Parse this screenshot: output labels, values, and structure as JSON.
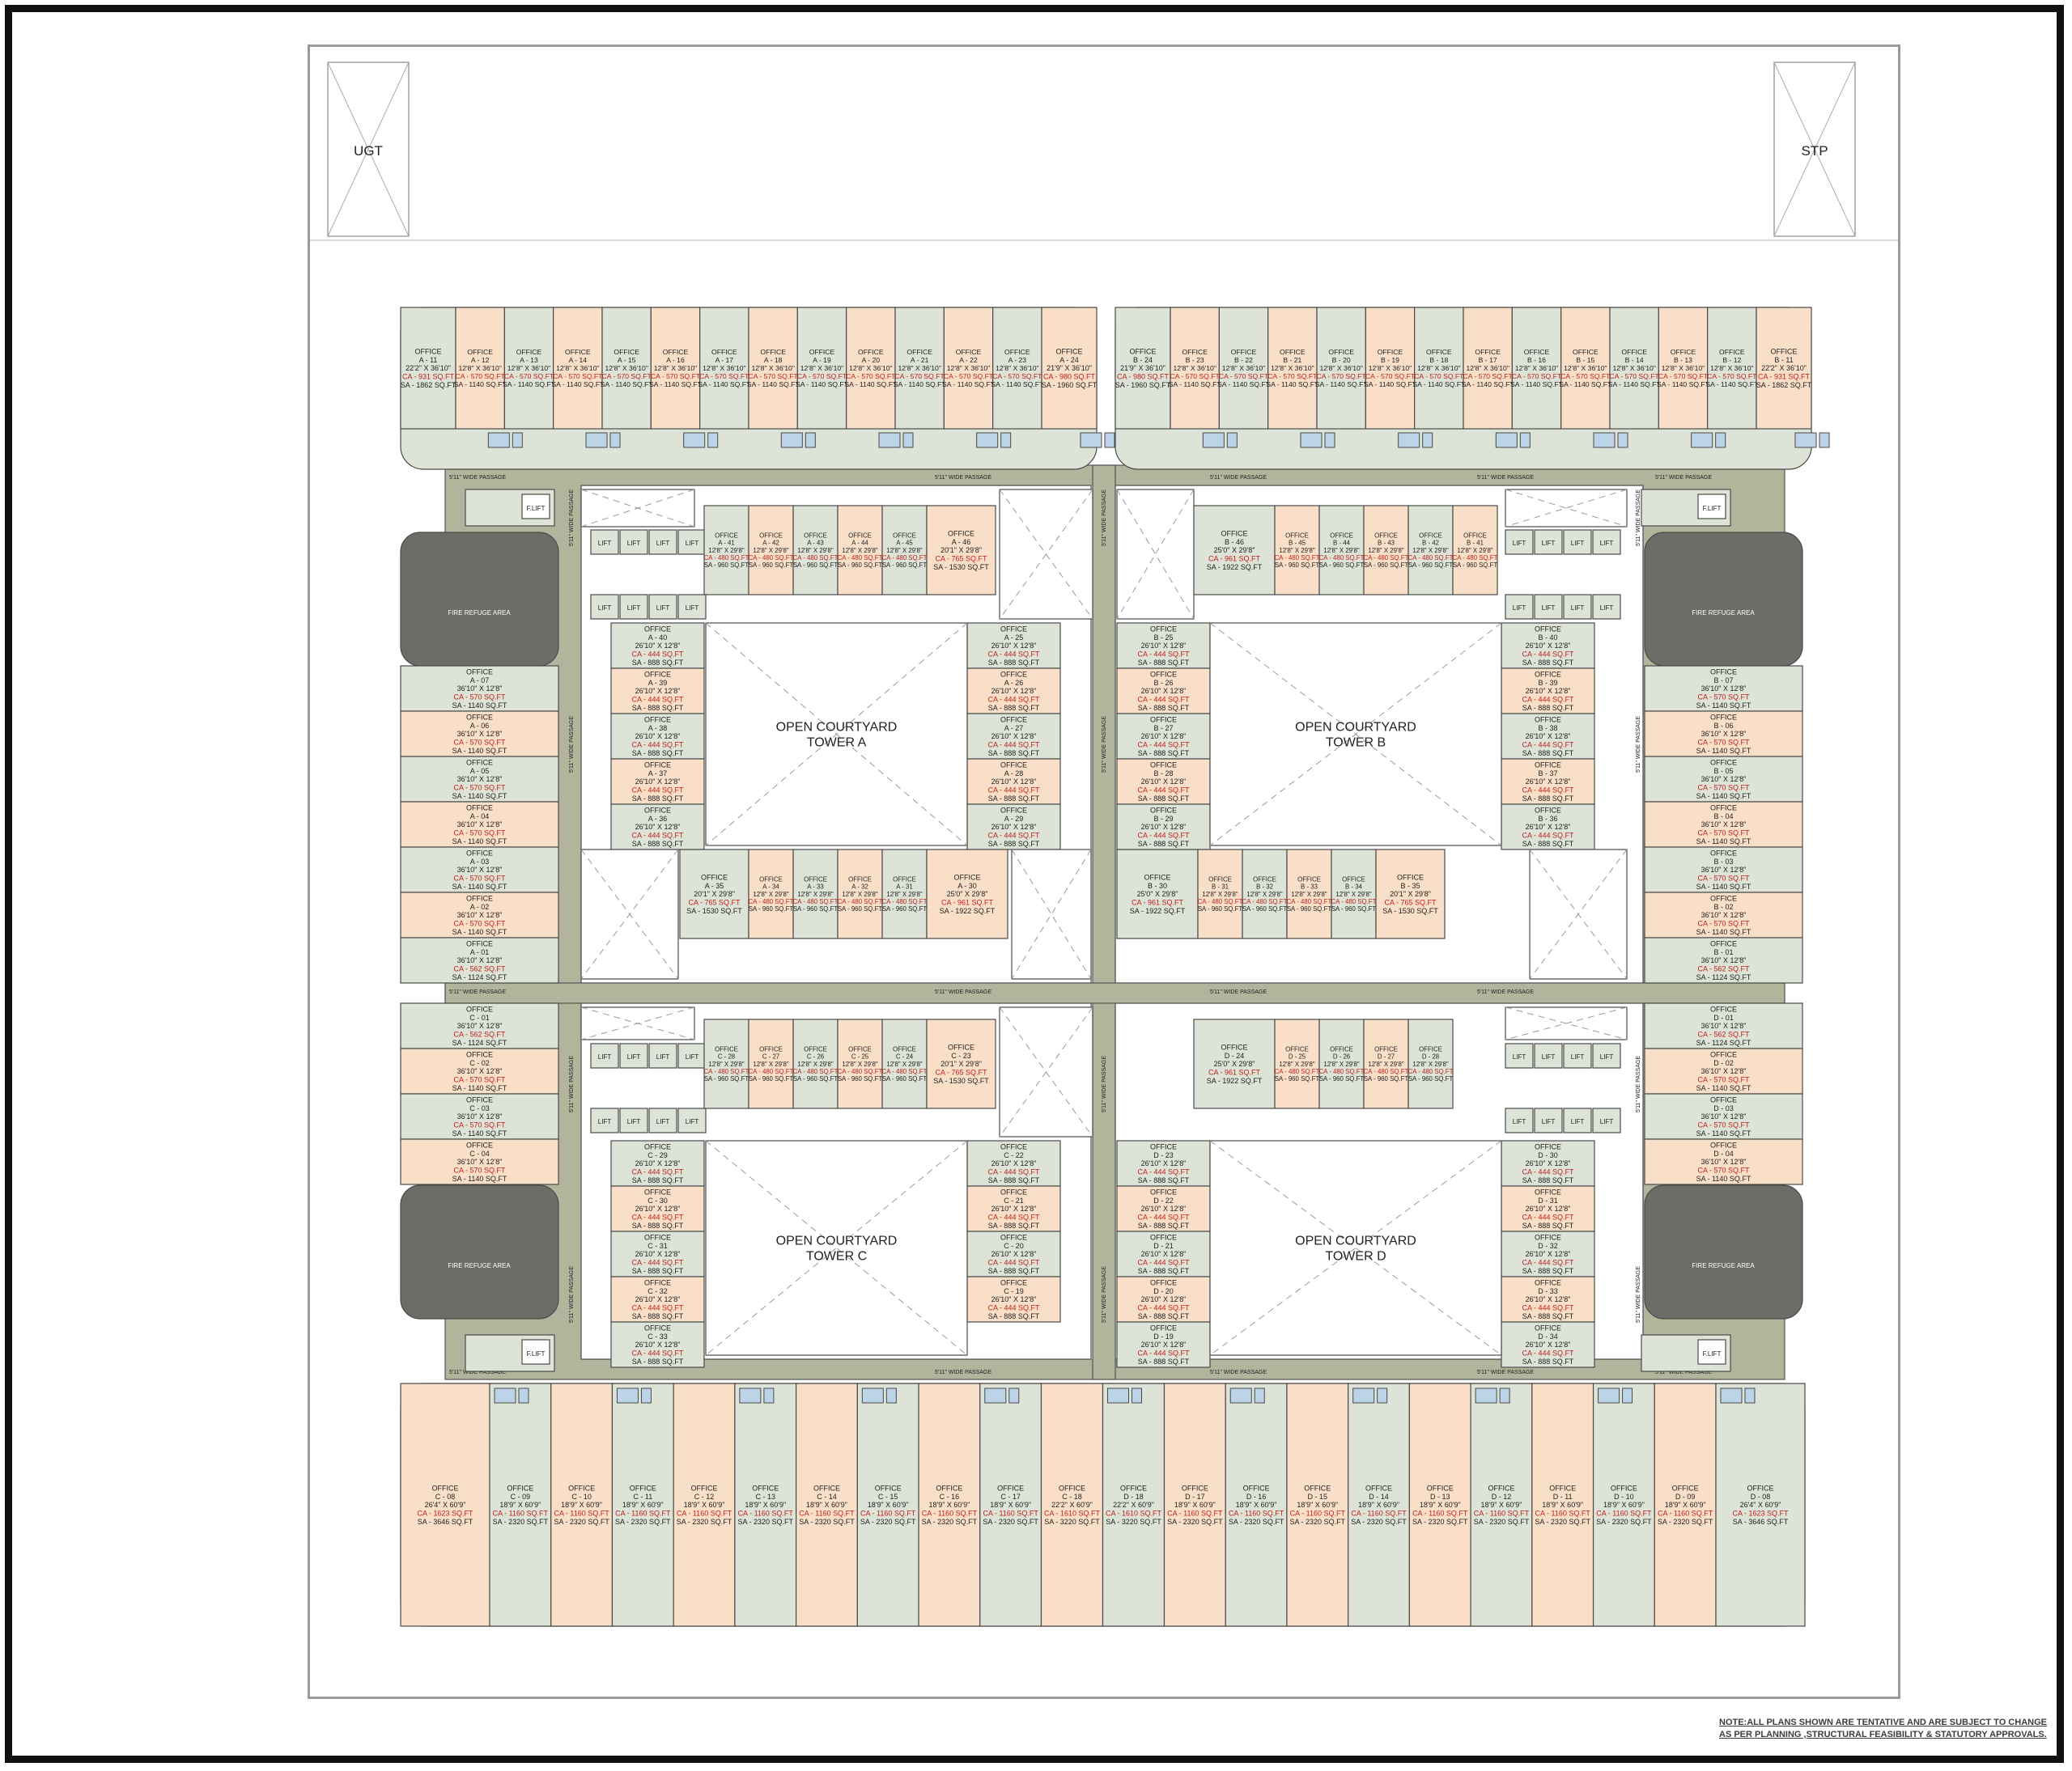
{
  "corner_tanks": [
    "UGT",
    "STP"
  ],
  "courtyards": [
    {
      "line1": "OPEN COURTYARD",
      "line2": "TOWER A"
    },
    {
      "line1": "OPEN COURTYARD",
      "line2": "TOWER B"
    },
    {
      "line1": "OPEN COURTYARD",
      "line2": "TOWER C"
    },
    {
      "line1": "OPEN COURTYARD",
      "line2": "TOWER D"
    }
  ],
  "labels": {
    "office": "OFFICE",
    "lift": "LIFT",
    "fire_lift": "F.LIFT",
    "fire_refuge_area": "FIRE REFUGE AREA",
    "passage_h": "5'11\" WIDE PASSAGE",
    "passage_v": "5'11\" WIDE PASSAGE"
  },
  "unit_sizes": {
    "top_end_a": {
      "dim": "22'2\" X 36'10\"",
      "ca": "CA - 931 SQ.FT",
      "sa": "SA - 1862 SQ.FT"
    },
    "top_mid": {
      "dim": "12'8\" X 36'10\"",
      "ca": "CA - 570 SQ.FT",
      "sa": "SA - 1140 SQ.FT"
    },
    "top_end_b": {
      "dim": "21'9\" X 36'10\"",
      "ca": "CA - 980 SQ.FT",
      "sa": "SA - 1960 SQ.FT"
    },
    "side": {
      "dim": "36'10\" X 12'8\"",
      "ca": "CA - 570 SQ.FT",
      "sa": "SA - 1140 SQ.FT"
    },
    "side_end": {
      "dim": "36'10\" X 12'8\"",
      "ca": "CA - 562 SQ.FT",
      "sa": "SA - 1124 SQ.FT"
    },
    "inner_side": {
      "dim": "26'10\" X 12'8\"",
      "ca": "CA - 444 SQ.FT",
      "sa": "SA - 888 SQ.FT"
    },
    "inner_row": {
      "dim": "12'8\" X 29'8\"",
      "ca": "CA - 480 SQ.FT",
      "sa": "SA - 960 SQ.FT"
    },
    "inner_row_wide": {
      "dim": "20'1\" X 29'8\"",
      "ca": "CA - 765 SQ.FT",
      "sa": "SA - 1530 SQ.FT"
    },
    "inner_row_corner": {
      "dim": "25'0\" X 29'8\"",
      "ca": "CA - 961 SQ.FT",
      "sa": "SA - 1922 SQ.FT"
    },
    "bottom_end": {
      "dim": "26'4\" X 60'9\"",
      "ca": "CA - 1623 SQ.FT",
      "sa": "SA - 3646 SQ.FT"
    },
    "bottom_mid": {
      "dim": "18'9\" X 60'9\"",
      "ca": "CA - 1160 SQ.FT",
      "sa": "SA - 2320 SQ.FT"
    },
    "bottom_center": {
      "dim": "22'2\" X 60'9\"",
      "ca": "CA - 1610 SQ.FT",
      "sa": "SA - 3220 SQ.FT"
    }
  },
  "blocks": {
    "top_a": [
      "A - 11",
      "A - 12",
      "A - 13",
      "A - 14",
      "A - 15",
      "A - 16",
      "A - 17",
      "A - 18",
      "A - 19",
      "A - 20",
      "A - 21",
      "A - 22",
      "A - 23",
      "A - 24"
    ],
    "top_b": [
      "B - 24",
      "B - 23",
      "B - 22",
      "B - 21",
      "B - 20",
      "B - 19",
      "B - 18",
      "B - 17",
      "B - 16",
      "B - 15",
      "B - 14",
      "B - 13",
      "B - 12",
      "B - 11"
    ],
    "left_a": [
      "A - 07",
      "A - 06",
      "A - 05",
      "A - 04",
      "A - 03",
      "A - 02",
      "A - 01"
    ],
    "right_b": [
      "B - 07",
      "B - 06",
      "B - 05",
      "B - 04",
      "B - 03",
      "B - 02",
      "B - 01"
    ],
    "left_c": [
      "C - 01",
      "C - 02",
      "C - 03",
      "C - 04"
    ],
    "right_d": [
      "D - 01",
      "D - 02",
      "D - 03",
      "D - 04"
    ],
    "bottom": [
      "C - 08",
      "C - 09",
      "C - 10",
      "C - 11",
      "C - 12",
      "C - 13",
      "C - 14",
      "C - 15",
      "C - 16",
      "C - 17",
      "C - 18",
      "D - 18",
      "D - 17",
      "D - 16",
      "D - 15",
      "D - 14",
      "D - 13",
      "D - 12",
      "D - 11",
      "D - 10",
      "D - 09",
      "D - 08"
    ],
    "a_top_row": [
      "A - 41",
      "A - 42",
      "A - 43",
      "A - 44",
      "A - 45",
      "A - 46"
    ],
    "a_left_col": [
      "A - 40",
      "A - 39",
      "A - 38",
      "A - 37",
      "A - 36"
    ],
    "a_right_col": [
      "A - 25",
      "A - 26",
      "A - 27",
      "A - 28",
      "A - 29"
    ],
    "a_bottom_row": [
      "A - 35",
      "A - 34",
      "A - 33",
      "A - 32",
      "A - 31",
      "A - 30"
    ],
    "b_top_row": [
      "B - 46",
      "B - 45",
      "B - 44",
      "B - 43",
      "B - 42",
      "B - 41"
    ],
    "b_left_col": [
      "B - 25",
      "B - 26",
      "B - 27",
      "B - 28",
      "B - 29"
    ],
    "b_right_col": [
      "B - 40",
      "B - 39",
      "B - 38",
      "B - 37",
      "B - 36"
    ],
    "b_bottom_row": [
      "B - 30",
      "B - 31",
      "B - 32",
      "B - 33",
      "B - 34",
      "B - 35"
    ],
    "c_top_row": [
      "C - 28",
      "C - 27",
      "C - 26",
      "C - 25",
      "C - 24",
      "C - 23"
    ],
    "c_left_col": [
      "C - 29",
      "C - 30",
      "C - 31",
      "C - 32",
      "C - 33"
    ],
    "c_right_col": [
      "C - 22",
      "C - 21",
      "C - 20",
      "C - 19"
    ],
    "d_top_row": [
      "D - 24",
      "D - 25",
      "D - 26",
      "D - 27",
      "D - 28"
    ],
    "d_left_col": [
      "D - 23",
      "D - 22",
      "D - 21",
      "D - 20",
      "D - 19"
    ],
    "d_right_col": [
      "D - 30",
      "D - 31",
      "D - 32",
      "D - 33",
      "D - 34"
    ]
  },
  "colors": {
    "unit_peach": "#f9dfc8",
    "unit_sage": "#dde3d6",
    "unit_stroke": "#4a4a4a",
    "passage": "#b2b49c",
    "refuge": "#6b6d66",
    "toilet": "#bcd3e8",
    "text_red": "#c0201a"
  },
  "note": {
    "line1": "NOTE:ALL PLANS SHOWN ARE TENTATIVE  AND ARE SUBJECT TO CHANGE",
    "line2": "AS PER PLANNING ,STRUCTURAL FEASIBILITY & STATUTORY APPROVALS."
  }
}
